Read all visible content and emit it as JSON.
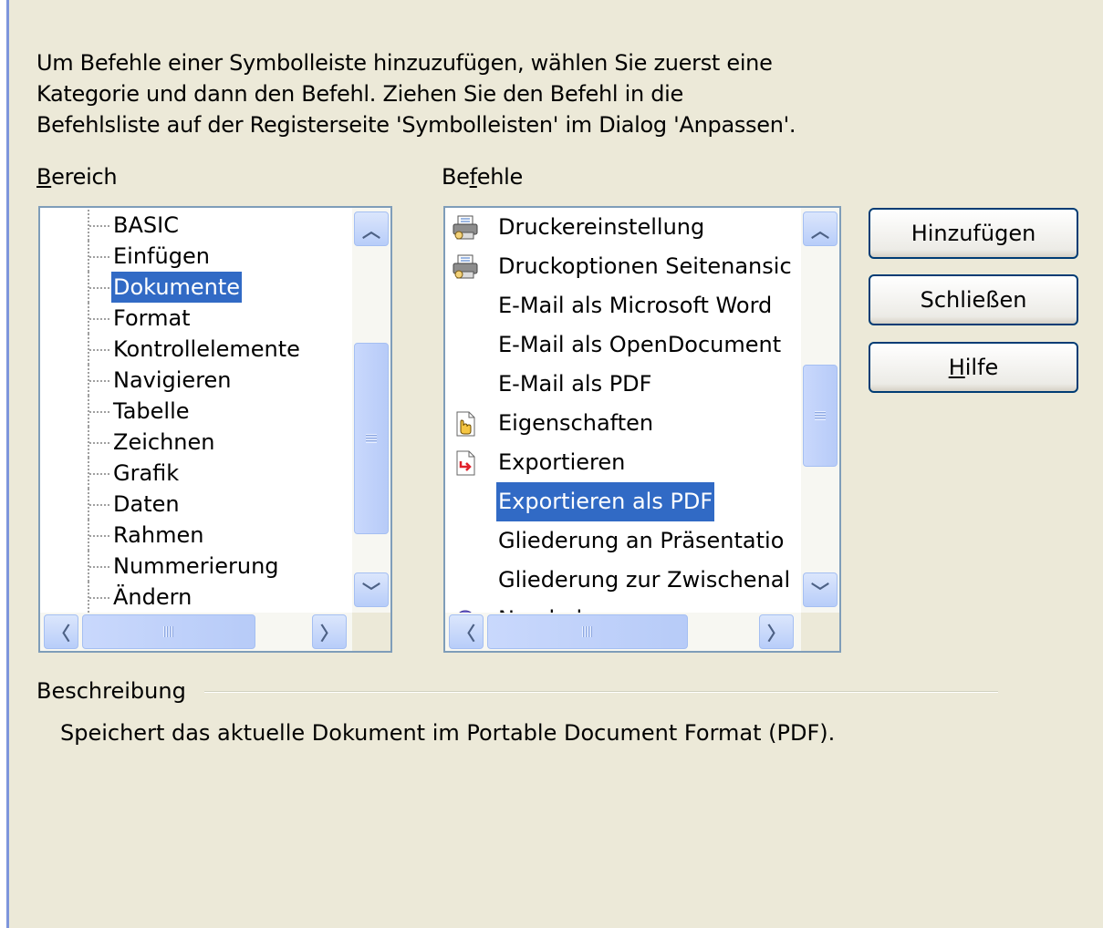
{
  "intro": {
    "lines": [
      "Um Befehle einer Symbolleiste hinzuzufügen, wählen Sie zuerst eine",
      "Kategorie und dann den Befehl. Ziehen Sie den Befehl in die",
      "Befehlsliste auf der Registerseite 'Symbolleisten' im Dialog 'Anpassen'."
    ]
  },
  "bereich": {
    "label_mnemonic": "B",
    "label_rest": "ereich",
    "items": [
      "BASIC",
      "Einfügen",
      "Dokumente",
      "Format",
      "Kontrollelemente",
      "Navigieren",
      "Tabelle",
      "Zeichnen",
      "Grafik",
      "Daten",
      "Rahmen",
      "Nummerierung",
      "Ändern"
    ],
    "selected": "Dokumente"
  },
  "befehle": {
    "label_pre": "Be",
    "label_mnemonic": "f",
    "label_rest": "ehle",
    "items": [
      {
        "label": "Druckereinstellung",
        "icon": "printer-icon"
      },
      {
        "label": "Druckoptionen Seitenansic",
        "icon": "printer-icon"
      },
      {
        "label": "E-Mail als Microsoft Word",
        "icon": ""
      },
      {
        "label": "E-Mail als OpenDocument",
        "icon": ""
      },
      {
        "label": "E-Mail als PDF",
        "icon": ""
      },
      {
        "label": "Eigenschaften",
        "icon": "document-properties-icon"
      },
      {
        "label": "Exportieren",
        "icon": "export-icon"
      },
      {
        "label": "Exportieren als PDF",
        "icon": ""
      },
      {
        "label": "Gliederung an Präsentatio",
        "icon": ""
      },
      {
        "label": "Gliederung zur Zwischenal",
        "icon": ""
      },
      {
        "label": "Neu laden",
        "icon": "reload-icon"
      }
    ],
    "selected": "Exportieren als PDF"
  },
  "buttons": {
    "add": "Hinzufügen",
    "close": "Schließen",
    "help_mnemonic": "H",
    "help_rest": "ilfe"
  },
  "description": {
    "label": "Beschreibung",
    "text": "Speichert das aktuelle Dokument im Portable Document Format (PDF)."
  },
  "colors": {
    "dialog_bg": "#ece9d8",
    "selection": "#316ac5",
    "list_border": "#7f9db9",
    "button_border": "#003c74"
  }
}
